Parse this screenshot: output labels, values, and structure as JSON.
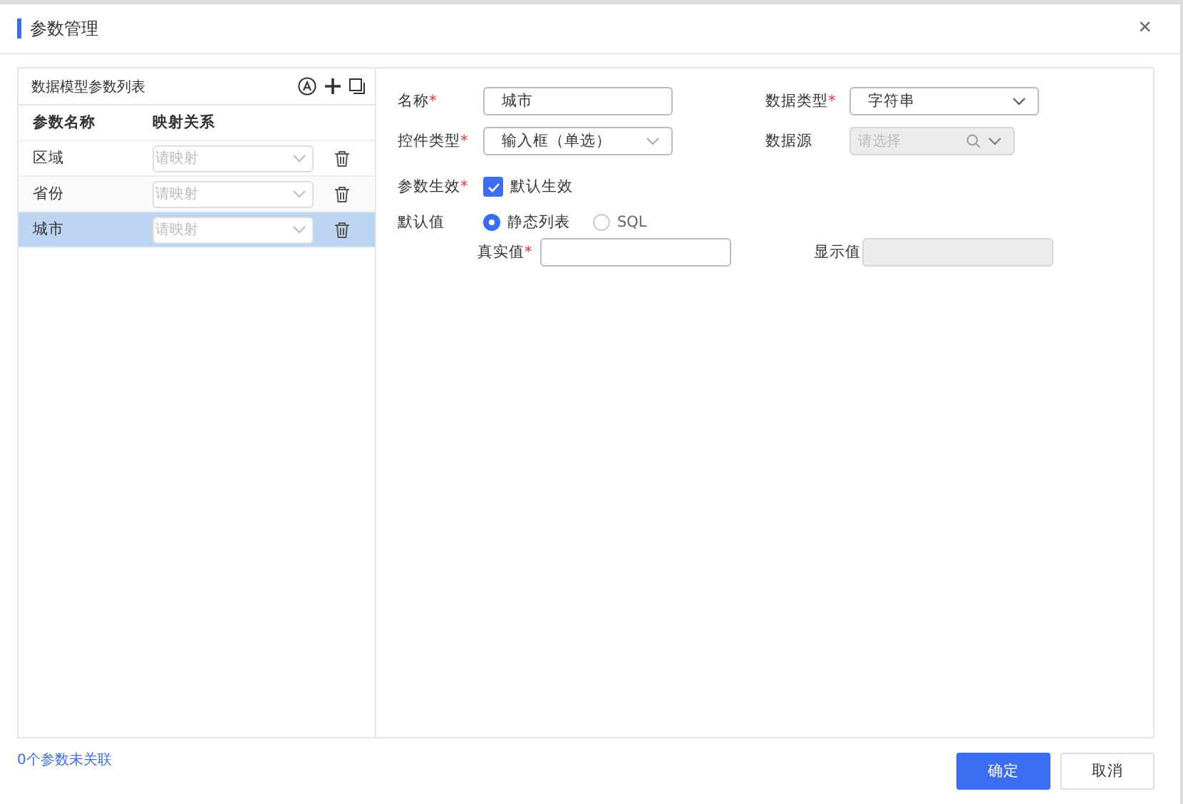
{
  "dialog": {
    "title": "参数管理",
    "close": "×"
  },
  "param_list": {
    "title": "数据模型参数列表",
    "columns": [
      "参数名称",
      "映射关系"
    ],
    "rows": [
      {
        "name": "区域",
        "mapping_placeholder": "请映射",
        "selected": false
      },
      {
        "name": "省份",
        "mapping_placeholder": "请映射",
        "selected": false
      },
      {
        "name": "城市",
        "mapping_placeholder": "请映射",
        "selected": true
      }
    ]
  },
  "form": {
    "name": {
      "label": "名称",
      "required_mark": "*",
      "value": "城市"
    },
    "data_type": {
      "label": "数据类型",
      "required_mark": "*",
      "value": "字符串"
    },
    "control_type": {
      "label": "控件类型",
      "required_mark": "*",
      "value": "输入框（单选）"
    },
    "data_source": {
      "label": "数据源",
      "placeholder": "请选择",
      "disabled": true
    },
    "effective": {
      "label": "参数生效",
      "required_mark": "*",
      "checkbox_label": "默认生效",
      "checked": true
    },
    "default_value": {
      "label": "默认值",
      "options": [
        {
          "label": "静态列表",
          "selected": true
        },
        {
          "label": "SQL",
          "selected": false
        }
      ]
    },
    "real_value": {
      "label": "真实值",
      "required_mark": "*",
      "disabled": false
    },
    "display_value": {
      "label": "显示值",
      "disabled": true
    }
  },
  "footer": {
    "unlinked": "0个参数未关联",
    "buttons": [
      {
        "label": "确定",
        "kind": "primary"
      },
      {
        "label": "取消",
        "kind": "default"
      }
    ]
  }
}
